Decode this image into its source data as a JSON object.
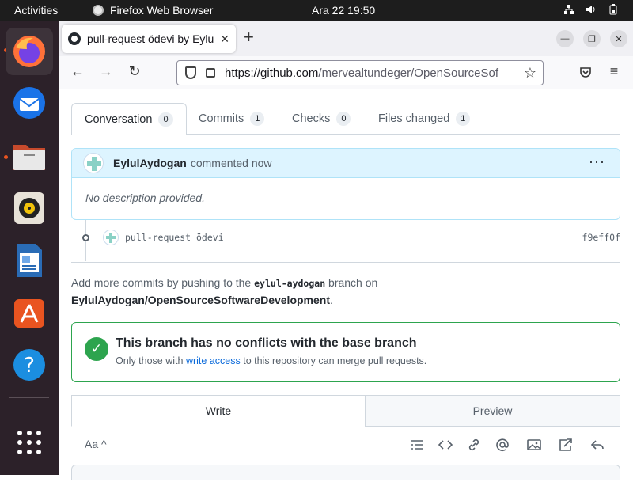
{
  "topbar": {
    "activities": "Activities",
    "app_name": "Firefox Web Browser",
    "clock": "Ara 22  19:50"
  },
  "dock": {
    "apps": [
      "firefox-icon",
      "thunderbird-icon",
      "files-icon",
      "rhythmbox-icon",
      "writer-icon",
      "app-center-icon",
      "help-icon",
      "show-apps-icon"
    ]
  },
  "browser": {
    "tab_title": "pull-request ödevi by Eylu",
    "url_host": "https://github.com",
    "url_path": "/mervealtundeger/OpenSourceSof"
  },
  "pr_tabs": [
    {
      "label": "Conversation",
      "count": "0"
    },
    {
      "label": "Commits",
      "count": "1"
    },
    {
      "label": "Checks",
      "count": "0"
    },
    {
      "label": "Files changed",
      "count": "1"
    }
  ],
  "comment": {
    "author": "EylulAydogan",
    "action": "commented now",
    "menu": "···",
    "body": "No description provided."
  },
  "commit": {
    "message": "pull-request ödevi",
    "sha": "f9eff0f"
  },
  "hint": {
    "prefix": "Add more commits by pushing to the",
    "branch": "eylul-aydogan",
    "middle": "branch on",
    "repo": "EylulAydogan/OpenSourceSoftwareDevelopment",
    "suffix": "."
  },
  "merge": {
    "title": "This branch has no conflicts with the base branch",
    "sub_prefix": "Only those with",
    "sub_link": "write access",
    "sub_suffix": "to this repository can merge pull requests."
  },
  "editor": {
    "write_tab": "Write",
    "preview_tab": "Preview",
    "text_style": "Aa"
  },
  "colors": {
    "accent_green": "#2da44e",
    "link_blue": "#0969da",
    "comment_header": "#ddf4ff",
    "dock_bg": "#2c2129",
    "ubuntu_orange": "#e95420"
  }
}
